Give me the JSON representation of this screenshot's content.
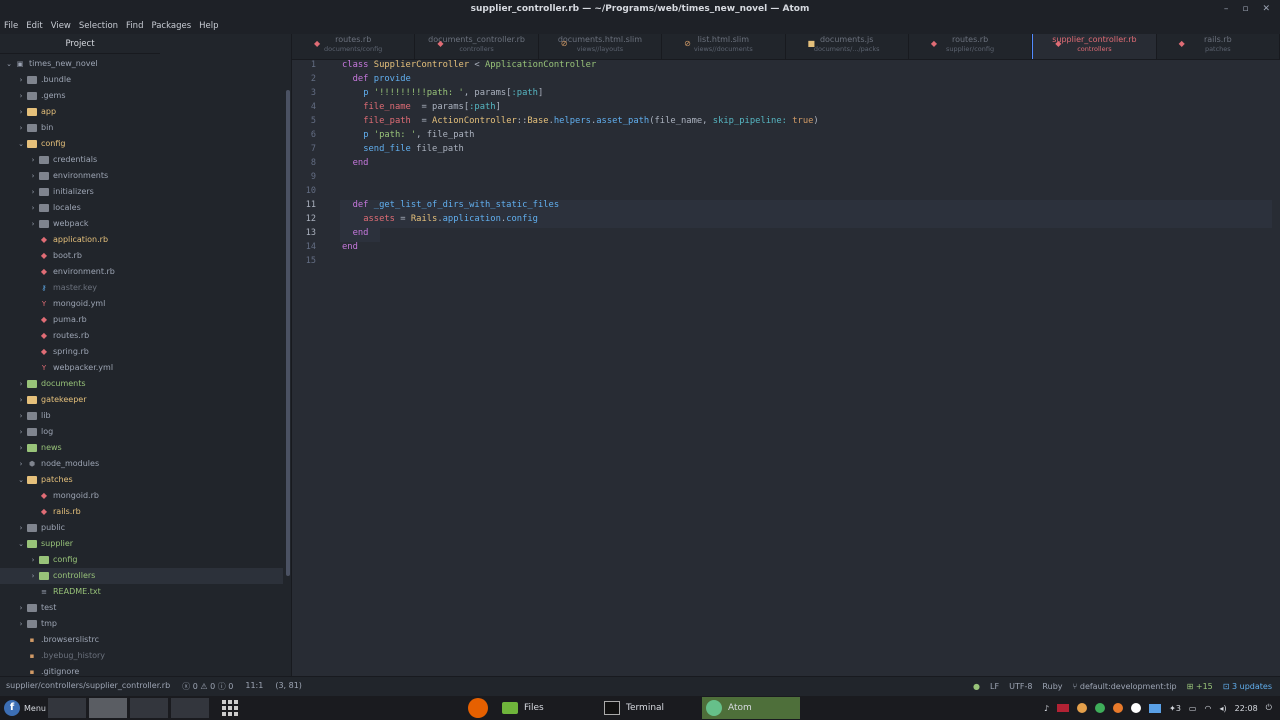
{
  "window": {
    "title": "supplier_controller.rb — ~/Programs/web/times_new_novel — Atom"
  },
  "menu": [
    "File",
    "Edit",
    "View",
    "Selection",
    "Find",
    "Packages",
    "Help"
  ],
  "sidebar": {
    "header": "Project",
    "items": [
      {
        "label": "times_new_novel",
        "depth": 0,
        "type": "root",
        "open": true
      },
      {
        "label": ".bundle",
        "depth": 1,
        "type": "folder",
        "open": false
      },
      {
        "label": ".gems",
        "depth": 1,
        "type": "folder",
        "open": false
      },
      {
        "label": "app",
        "depth": 1,
        "type": "folder",
        "open": false,
        "color": "y"
      },
      {
        "label": "bin",
        "depth": 1,
        "type": "folder",
        "open": false
      },
      {
        "label": "config",
        "depth": 1,
        "type": "folder",
        "open": true,
        "color": "y"
      },
      {
        "label": "credentials",
        "depth": 2,
        "type": "folder",
        "open": false
      },
      {
        "label": "environments",
        "depth": 2,
        "type": "folder",
        "open": false
      },
      {
        "label": "initializers",
        "depth": 2,
        "type": "folder",
        "open": false
      },
      {
        "label": "locales",
        "depth": 2,
        "type": "folder",
        "open": false
      },
      {
        "label": "webpack",
        "depth": 2,
        "type": "folder",
        "open": false
      },
      {
        "label": "application.rb",
        "depth": 2,
        "type": "ruby",
        "color": "y"
      },
      {
        "label": "boot.rb",
        "depth": 2,
        "type": "ruby"
      },
      {
        "label": "environment.rb",
        "depth": 2,
        "type": "ruby"
      },
      {
        "label": "master.key",
        "depth": 2,
        "type": "key",
        "color": "d"
      },
      {
        "label": "mongoid.yml",
        "depth": 2,
        "type": "yml"
      },
      {
        "label": "puma.rb",
        "depth": 2,
        "type": "ruby"
      },
      {
        "label": "routes.rb",
        "depth": 2,
        "type": "ruby"
      },
      {
        "label": "spring.rb",
        "depth": 2,
        "type": "ruby"
      },
      {
        "label": "webpacker.yml",
        "depth": 2,
        "type": "yml"
      },
      {
        "label": "documents",
        "depth": 1,
        "type": "folder",
        "open": false,
        "color": "g"
      },
      {
        "label": "gatekeeper",
        "depth": 1,
        "type": "folder",
        "open": false,
        "color": "y"
      },
      {
        "label": "lib",
        "depth": 1,
        "type": "folder",
        "open": false
      },
      {
        "label": "log",
        "depth": 1,
        "type": "folder",
        "open": false
      },
      {
        "label": "news",
        "depth": 1,
        "type": "folder",
        "open": false,
        "color": "g"
      },
      {
        "label": "node_modules",
        "depth": 1,
        "type": "module",
        "open": false
      },
      {
        "label": "patches",
        "depth": 1,
        "type": "folder",
        "open": true,
        "color": "y"
      },
      {
        "label": "mongoid.rb",
        "depth": 2,
        "type": "ruby"
      },
      {
        "label": "rails.rb",
        "depth": 2,
        "type": "ruby",
        "color": "y"
      },
      {
        "label": "public",
        "depth": 1,
        "type": "folder",
        "open": false
      },
      {
        "label": "supplier",
        "depth": 1,
        "type": "folder",
        "open": true,
        "color": "g"
      },
      {
        "label": "config",
        "depth": 2,
        "type": "folder",
        "open": false,
        "color": "g"
      },
      {
        "label": "controllers",
        "depth": 2,
        "type": "folder",
        "open": false,
        "color": "g",
        "selected": true
      },
      {
        "label": "README.txt",
        "depth": 2,
        "type": "txt",
        "color": "g"
      },
      {
        "label": "test",
        "depth": 1,
        "type": "folder",
        "open": false
      },
      {
        "label": "tmp",
        "depth": 1,
        "type": "folder",
        "open": false
      },
      {
        "label": ".browserslistrc",
        "depth": 1,
        "type": "file"
      },
      {
        "label": ".byebug_history",
        "depth": 1,
        "type": "file",
        "color": "d"
      },
      {
        "label": ".gitignore",
        "depth": 1,
        "type": "file"
      }
    ]
  },
  "tabs": [
    {
      "name": "routes.rb",
      "path": "documents/config",
      "icon": "ruby-icon"
    },
    {
      "name": "documents_controller.rb",
      "path": "controllers",
      "icon": "ruby-icon"
    },
    {
      "name": "documents.html.slim",
      "path": "views//layouts",
      "icon": "slim-icon"
    },
    {
      "name": "list.html.slim",
      "path": "views//documents",
      "icon": "slim-icon"
    },
    {
      "name": "documents.js",
      "path": "documents/.../packs",
      "icon": "js-icon"
    },
    {
      "name": "routes.rb",
      "path": "supplier/config",
      "icon": "ruby-icon"
    },
    {
      "name": "supplier_controller.rb",
      "path": "controllers",
      "icon": "ruby-icon",
      "active": true
    },
    {
      "name": "rails.rb",
      "path": "patches",
      "icon": "ruby-icon"
    }
  ],
  "code_lines": [
    "1",
    "2",
    "3",
    "4",
    "5",
    "6",
    "7",
    "8",
    "9",
    "10",
    "11",
    "12",
    "13",
    "14",
    "15"
  ],
  "status": {
    "path": "supplier/controllers/supplier_controller.rb",
    "errors": "0",
    "warnings": "0",
    "info": "0",
    "cursor": "11:1",
    "selection": "(3, 81)",
    "eol": "LF",
    "encoding": "UTF-8",
    "grammar": "Ruby",
    "branch": "default:development:tip",
    "diff": "+15",
    "updates": "3 updates"
  },
  "taskbar": {
    "menu": "Menu",
    "apps": [
      "Files",
      "Terminal",
      "Atom"
    ],
    "time": "22:08",
    "volume": "3"
  }
}
